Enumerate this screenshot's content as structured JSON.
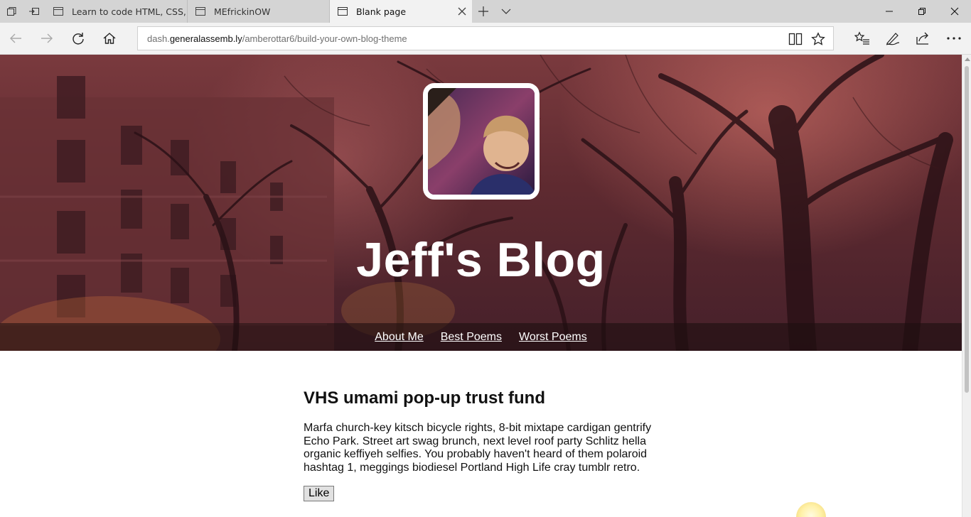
{
  "browser": {
    "tabs": [
      {
        "title": "Learn to code HTML, CSS, a",
        "active": false
      },
      {
        "title": "MEfrickinOW",
        "active": false
      },
      {
        "title": "Blank page",
        "active": true
      }
    ],
    "address": {
      "prefix": "dash.",
      "host": "generalassemb.ly",
      "path": "/amberottar6/build-your-own-blog-theme"
    },
    "icons": {
      "tab_manager": "tab-manager-icon",
      "set_aside": "set-aside-icon",
      "new_tab": "plus-icon",
      "tab_list": "chevron-down-icon",
      "back": "back-arrow-icon",
      "forward": "forward-arrow-icon",
      "refresh": "refresh-icon",
      "home": "home-icon",
      "reading_view": "book-icon",
      "favorite": "star-icon",
      "favorites_hub": "favorites-list-icon",
      "notes": "pen-icon",
      "share": "share-icon",
      "more": "more-icon"
    }
  },
  "page": {
    "blog_title": "Jeff's Blog",
    "nav": [
      "About Me",
      "Best Poems",
      "Worst Poems"
    ],
    "post": {
      "title": "VHS umami pop-up trust fund",
      "body": "Marfa church-key kitsch bicycle rights, 8-bit mixtape cardigan gentrify Echo Park. Street art swag brunch, next level roof party Schlitz hella organic keffiyeh selfies. You probably haven't heard of them polaroid hashtag 1, meggings biodiesel Portland High Life cray tumblr retro.",
      "like_label": "Like"
    }
  },
  "colors": {
    "hero_overlay": "#6e3238",
    "nav_bar": "#1e0e10",
    "tabstrip": "#d4d4d4",
    "toolbar": "#f2f2f2"
  }
}
